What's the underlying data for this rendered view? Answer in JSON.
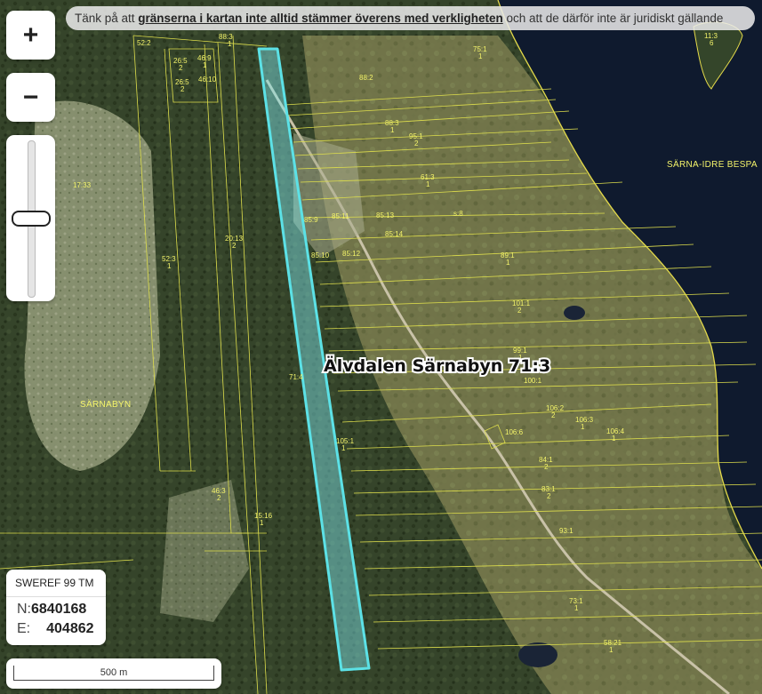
{
  "notice": {
    "part1": "Tänk på att ",
    "emphasis1": "gränserna i kartan inte alltid stämmer överens med verkligheten",
    "part2": " och att de därför inte är juridiskt gällande"
  },
  "zoom": {
    "in_label": "+",
    "out_label": "−",
    "level_fraction": 0.5
  },
  "property": {
    "label": "Älvdalen Särnabyn 71:3",
    "highlight_color": "#5ce1e6"
  },
  "coordinates": {
    "crs": "SWEREF 99 TM",
    "n_label": "N:",
    "n_value": "6840168",
    "e_label": "E:",
    "e_value": "404862"
  },
  "scale": {
    "label": "500 m"
  },
  "places": {
    "village": "SÄRNABYN",
    "lake": "SÄRNA-IDRE BESPA"
  },
  "parcels": [
    {
      "id": "p1",
      "l1": "52:2",
      "l2": ""
    },
    {
      "id": "p2",
      "l1": "88:3",
      "l2": "1"
    },
    {
      "id": "p3",
      "l1": "46:9",
      "l2": "1"
    },
    {
      "id": "p4",
      "l1": "26:5",
      "l2": "2"
    },
    {
      "id": "p5",
      "l1": "26:5",
      "l2": "2"
    },
    {
      "id": "p6",
      "l1": "46:10",
      "l2": ""
    },
    {
      "id": "p7",
      "l1": "75:1",
      "l2": "1"
    },
    {
      "id": "p8",
      "l1": "88:2",
      "l2": ""
    },
    {
      "id": "p9",
      "l1": "11:3",
      "l2": "6"
    },
    {
      "id": "p10",
      "l1": "88:3",
      "l2": "1"
    },
    {
      "id": "p11",
      "l1": "95:1",
      "l2": "2"
    },
    {
      "id": "p12",
      "l1": "17:33",
      "l2": ""
    },
    {
      "id": "p13",
      "l1": "61:3",
      "l2": "1"
    },
    {
      "id": "p14",
      "l1": "85:9",
      "l2": ""
    },
    {
      "id": "p15",
      "l1": "85:11",
      "l2": ""
    },
    {
      "id": "p16",
      "l1": "85:13",
      "l2": ""
    },
    {
      "id": "p17",
      "l1": "s:8",
      "l2": ""
    },
    {
      "id": "p18",
      "l1": "85:14",
      "l2": ""
    },
    {
      "id": "p19",
      "l1": "20:13",
      "l2": "2"
    },
    {
      "id": "p20",
      "l1": "85:10",
      "l2": ""
    },
    {
      "id": "p21",
      "l1": "85:12",
      "l2": ""
    },
    {
      "id": "p22",
      "l1": "89:1",
      "l2": "1"
    },
    {
      "id": "p23",
      "l1": "52:3",
      "l2": "1"
    },
    {
      "id": "p24",
      "l1": "101:1",
      "l2": "2"
    },
    {
      "id": "p25",
      "l1": "99:1",
      "l2": "1"
    },
    {
      "id": "p26",
      "l1": "100:1",
      "l2": ""
    },
    {
      "id": "p27",
      "l1": "71:4",
      "l2": ""
    },
    {
      "id": "p28",
      "l1": "106:2",
      "l2": "2"
    },
    {
      "id": "p29",
      "l1": "106:3",
      "l2": "1"
    },
    {
      "id": "p30",
      "l1": "106:4",
      "l2": "1"
    },
    {
      "id": "p31",
      "l1": "106:6",
      "l2": ""
    },
    {
      "id": "p32",
      "l1": "105:1",
      "l2": "1"
    },
    {
      "id": "p33",
      "l1": "84:1",
      "l2": "2"
    },
    {
      "id": "p34",
      "l1": "83:1",
      "l2": "2"
    },
    {
      "id": "p35",
      "l1": "46:3",
      "l2": "2"
    },
    {
      "id": "p36",
      "l1": "15:16",
      "l2": "1"
    },
    {
      "id": "p37",
      "l1": "93:1",
      "l2": ""
    },
    {
      "id": "p38",
      "l1": "73:1",
      "l2": "1"
    },
    {
      "id": "p39",
      "l1": "58:21",
      "l2": "1"
    }
  ]
}
